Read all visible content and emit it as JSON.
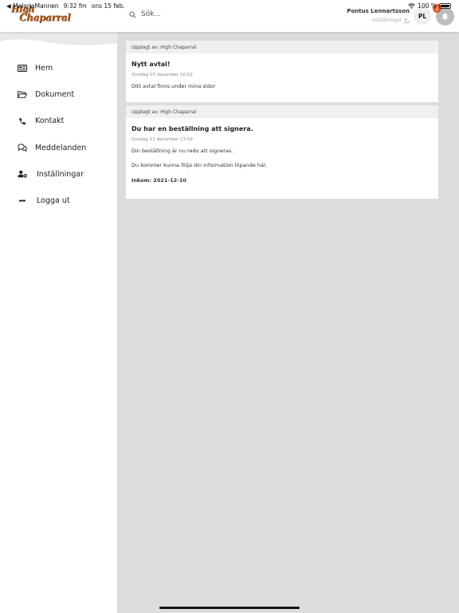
{
  "statusbar": {
    "back_app": "◀ MalariaMannen",
    "time": "9:32 fm",
    "date": "ons 15 feb.",
    "battery": "100 %"
  },
  "header": {
    "logo_line1": "High",
    "logo_line2": "Chaparral",
    "search_placeholder": "Sök...",
    "user_name": "Pontus Lennartsson",
    "user_settings": "Inställningar",
    "avatar_initials": "PL",
    "notification_count": "1"
  },
  "sidebar": {
    "items": [
      {
        "label": "Hem",
        "icon": "newspaper-icon"
      },
      {
        "label": "Dokument",
        "icon": "folder-open-icon"
      },
      {
        "label": "Kontakt",
        "icon": "phone-icon"
      },
      {
        "label": "Meddelanden",
        "icon": "chat-icon"
      },
      {
        "label": "Inställningar",
        "icon": "user-gear-icon"
      },
      {
        "label": "Logga ut",
        "icon": "minus-icon"
      }
    ]
  },
  "cards": [
    {
      "uploaded_by": "Upplagt av: High Chaparral",
      "title": "Nytt avtal!",
      "date": "Onsdag 15 december 10:02",
      "text": "Ditt avtal finns under mina sidor"
    },
    {
      "uploaded_by": "Upplagt av: High Chaparral",
      "title": "Du har en beställning att signera.",
      "date": "Onsdag 11 december 13:09",
      "text": "Din beställning är nu redo att signeras.",
      "text2": "Du kommer kunna följa din information löpande här.",
      "inkom": "Inkom: 2021-12-10"
    }
  ],
  "colors": {
    "accent_badge": "#e05a2b",
    "logo": "#a8581c",
    "background": "#dcdcdc"
  }
}
